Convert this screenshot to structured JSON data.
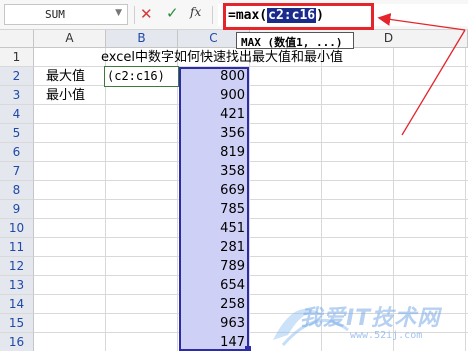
{
  "formula_bar": {
    "name_box": "SUM",
    "formula_prefix": "=max(",
    "formula_arg": "c2:c16",
    "formula_suffix": ")",
    "fx_label": "fx"
  },
  "tooltip": "MAX (数值1, ...)",
  "columns": [
    "A",
    "B",
    "C",
    "D"
  ],
  "rows": [
    "1",
    "2",
    "3",
    "4",
    "5",
    "6",
    "7",
    "8",
    "9",
    "10",
    "11",
    "12",
    "13",
    "14",
    "15",
    "16"
  ],
  "cells": {
    "title": "excel中数字如何快速找出最大值和最小值",
    "label_max": "最大值",
    "label_min": "最小值",
    "editing": "(c2:c16)"
  },
  "c_values": [
    "800",
    "900",
    "421",
    "356",
    "819",
    "358",
    "669",
    "785",
    "451",
    "281",
    "789",
    "654",
    "258",
    "963",
    "147"
  ],
  "watermark": {
    "text": "我爱IT技术网",
    "url": "www.52ij.com"
  },
  "colors": {
    "highlight_red": "#e4252b",
    "range_fill": "#cfd0f5",
    "range_border": "#2c2ca8"
  }
}
